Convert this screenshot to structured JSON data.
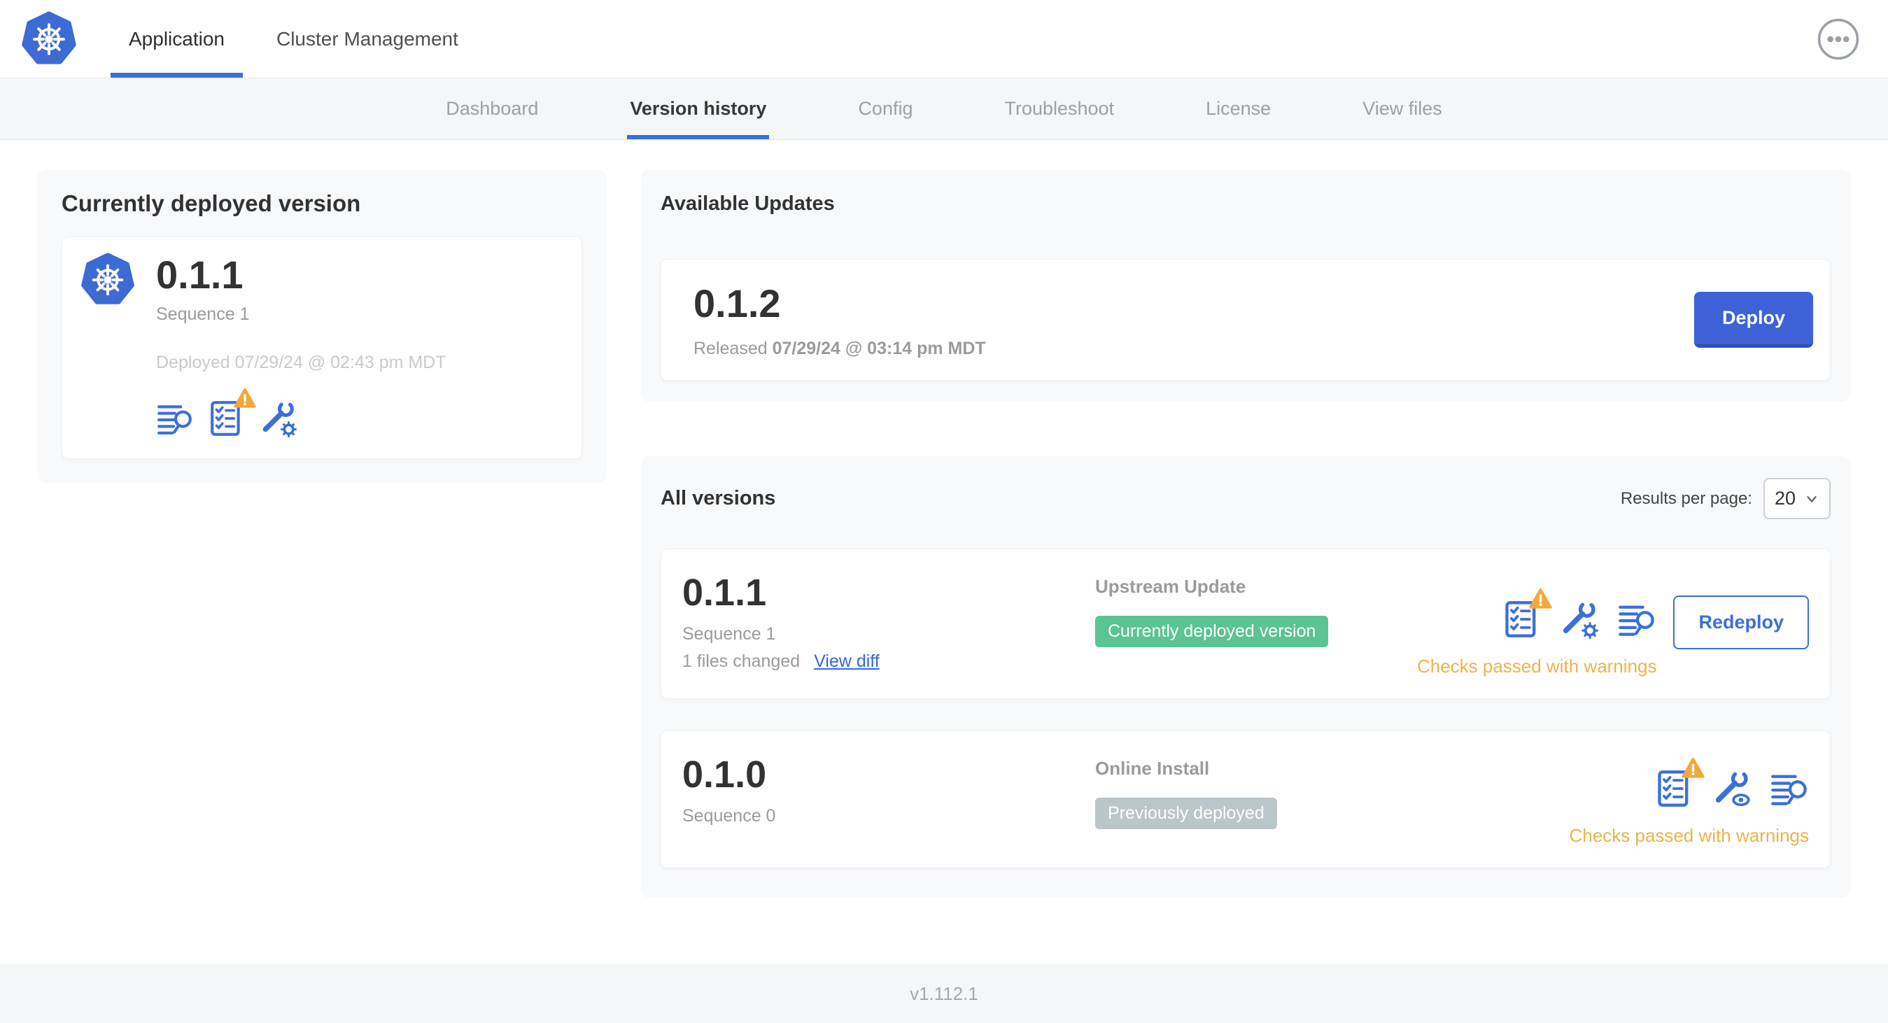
{
  "topnav": {
    "tabs": [
      {
        "label": "Application",
        "active": true
      },
      {
        "label": "Cluster Management",
        "active": false
      }
    ]
  },
  "subnav": {
    "items": [
      {
        "label": "Dashboard",
        "active": false
      },
      {
        "label": "Version history",
        "active": true
      },
      {
        "label": "Config",
        "active": false
      },
      {
        "label": "Troubleshoot",
        "active": false
      },
      {
        "label": "License",
        "active": false
      },
      {
        "label": "View files",
        "active": false
      }
    ]
  },
  "currently_deployed": {
    "title": "Currently deployed version",
    "version": "0.1.1",
    "sequence": "Sequence 1",
    "deployed_at": "Deployed 07/29/24 @ 02:43 pm MDT",
    "icons": [
      "diff-logs-icon",
      "preflight-checks-warning-icon",
      "config-gear-icon"
    ]
  },
  "available_updates": {
    "title": "Available Updates",
    "version": "0.1.2",
    "released_prefix": "Released",
    "released_date": "07/29/24 @ 03:14 pm MDT",
    "deploy_button": "Deploy"
  },
  "all_versions": {
    "title": "All versions",
    "results_per_page_label": "Results per page:",
    "results_per_page_value": "20",
    "rows": [
      {
        "version": "0.1.1",
        "sequence": "Sequence 1",
        "files_changed": "1 files changed",
        "view_diff_link": "View diff",
        "source": "Upstream Update",
        "badge_label": "Currently deployed version",
        "badge_color": "#5cc392",
        "status": "Checks passed with warnings",
        "action_button": "Redeploy",
        "icons": [
          "preflight-checks-warning-icon",
          "config-gear-icon",
          "diff-logs-icon"
        ]
      },
      {
        "version": "0.1.0",
        "sequence": "Sequence 0",
        "source": "Online Install",
        "badge_label": "Previously deployed",
        "badge_color": "#b9c6ca",
        "status": "Checks passed with warnings",
        "icons": [
          "preflight-checks-warning-icon",
          "config-view-icon",
          "diff-logs-icon"
        ]
      }
    ]
  },
  "footer": {
    "app_version": "v1.112.1"
  },
  "colors": {
    "accent_blue": "#3b6fd9",
    "deploy_button_blue": "#3e61d8",
    "kubernetes_blue": "#3e6ad4",
    "success_green": "#5cc392",
    "muted_badge_gray": "#b9c6ca",
    "warning_orange": "#edb24b",
    "warning_triangle_orange": "#f0a93c"
  }
}
